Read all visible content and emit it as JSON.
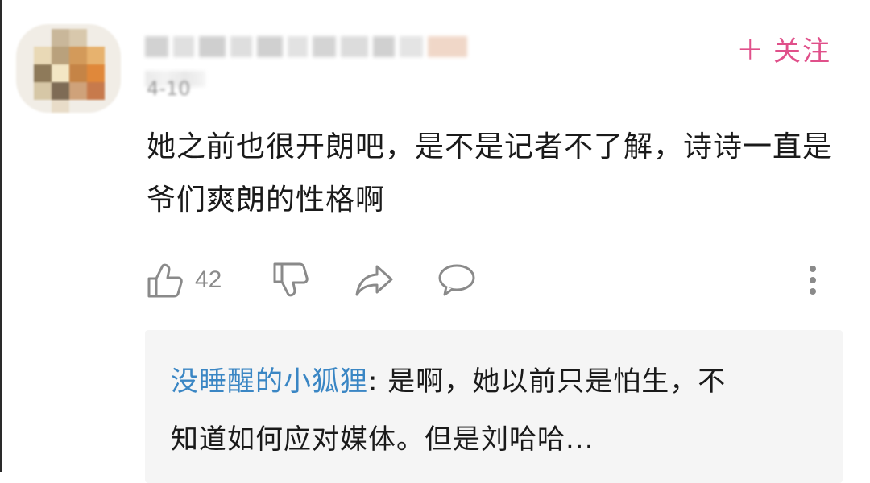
{
  "header": {
    "follow_plus": "+",
    "follow_label": "关注",
    "date": "4-10"
  },
  "comment": {
    "text": "她之前也很开朗吧，是不是记者不了解，诗诗一直是爷们爽朗的性格啊"
  },
  "actions": {
    "like_count": "42",
    "icons": [
      "thumbs-up-icon",
      "thumbs-down-icon",
      "share-icon",
      "comment-icon",
      "more-icon"
    ]
  },
  "reply": {
    "username": "没睡醒的小狐狸",
    "separator": ": ",
    "text": "是啊，她以前只是怕生，不知道如何应对媒体。但是刘哈哈..."
  },
  "colors": {
    "accent": "#e0508a",
    "reply_username": "#3a86c4",
    "muted": "#8a8a8a",
    "reply_bg": "#f5f5f5"
  }
}
